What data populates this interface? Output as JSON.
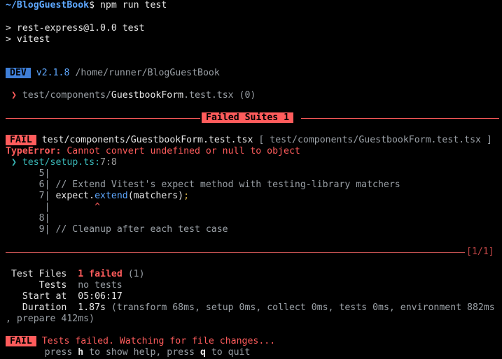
{
  "prompt": {
    "path": "~/BlogGuestBook",
    "dollar": "$",
    "command": " npm run test"
  },
  "npm": {
    "line1": "> rest-express@1.0.0 test",
    "line2": "> vitest"
  },
  "dev": {
    "badge": "DEV",
    "version": "v2.1.8",
    "path": "/home/runner/BlogGuestBook"
  },
  "running": {
    "arrow": "❯",
    "dir": "test/components/",
    "file": "GuestbookForm",
    "ext": ".test.tsx",
    "count": "(0)"
  },
  "failed_suites": {
    "label": "Failed Suites 1"
  },
  "fail_header": {
    "badge": "FAIL",
    "file": "test/components/GuestbookForm.test.tsx",
    "bracket_open": "[",
    "bracket_file": "test/components/GuestbookForm.test.tsx",
    "bracket_close": "]"
  },
  "error": {
    "type": "TypeError:",
    "message": "Cannot convert undefined or null to object"
  },
  "location": {
    "arrow": "❯",
    "file": "test/setup.ts:",
    "pos": "7:8"
  },
  "code": {
    "l5_num": "5|",
    "l6_num": "6|",
    "l6_text": "// Extend Vitest's expect method with testing-library matchers",
    "l7_num": "7|",
    "l7_a": "expect.",
    "l7_b": "extend",
    "l7_c": "(matchers)",
    "l7_d": ";",
    "pipe": "|",
    "caret": "^",
    "l8_num": "8|",
    "l9_num": "9|",
    "l9_text": "// Cleanup after each test case"
  },
  "pager": "[1/1]",
  "summary": {
    "files_label": "Test Files",
    "files_failed": "1 failed",
    "files_total": "(1)",
    "tests_label": "Tests",
    "tests_value": "no tests",
    "start_label": "Start at",
    "start_value": "05:06:17",
    "duration_label": "Duration",
    "duration_value": "1.87s",
    "duration_detail": "(transform 68ms, setup 0ms, collect 0ms, tests 0ms, environment 882ms",
    "duration_cont": ", prepare 412ms)"
  },
  "footer": {
    "badge": "FAIL",
    "message": "Tests failed. Watching for file changes...",
    "help_a": "press",
    "help_h": "h",
    "help_b": "to show help, press",
    "help_q": "q",
    "help_c": "to quit"
  },
  "colors": {
    "background": "#000000",
    "text": "#e6e6e6",
    "accent_blue": "#5ea8ff",
    "fail_red": "#ff5c5c",
    "cyan": "#39b6b6"
  }
}
